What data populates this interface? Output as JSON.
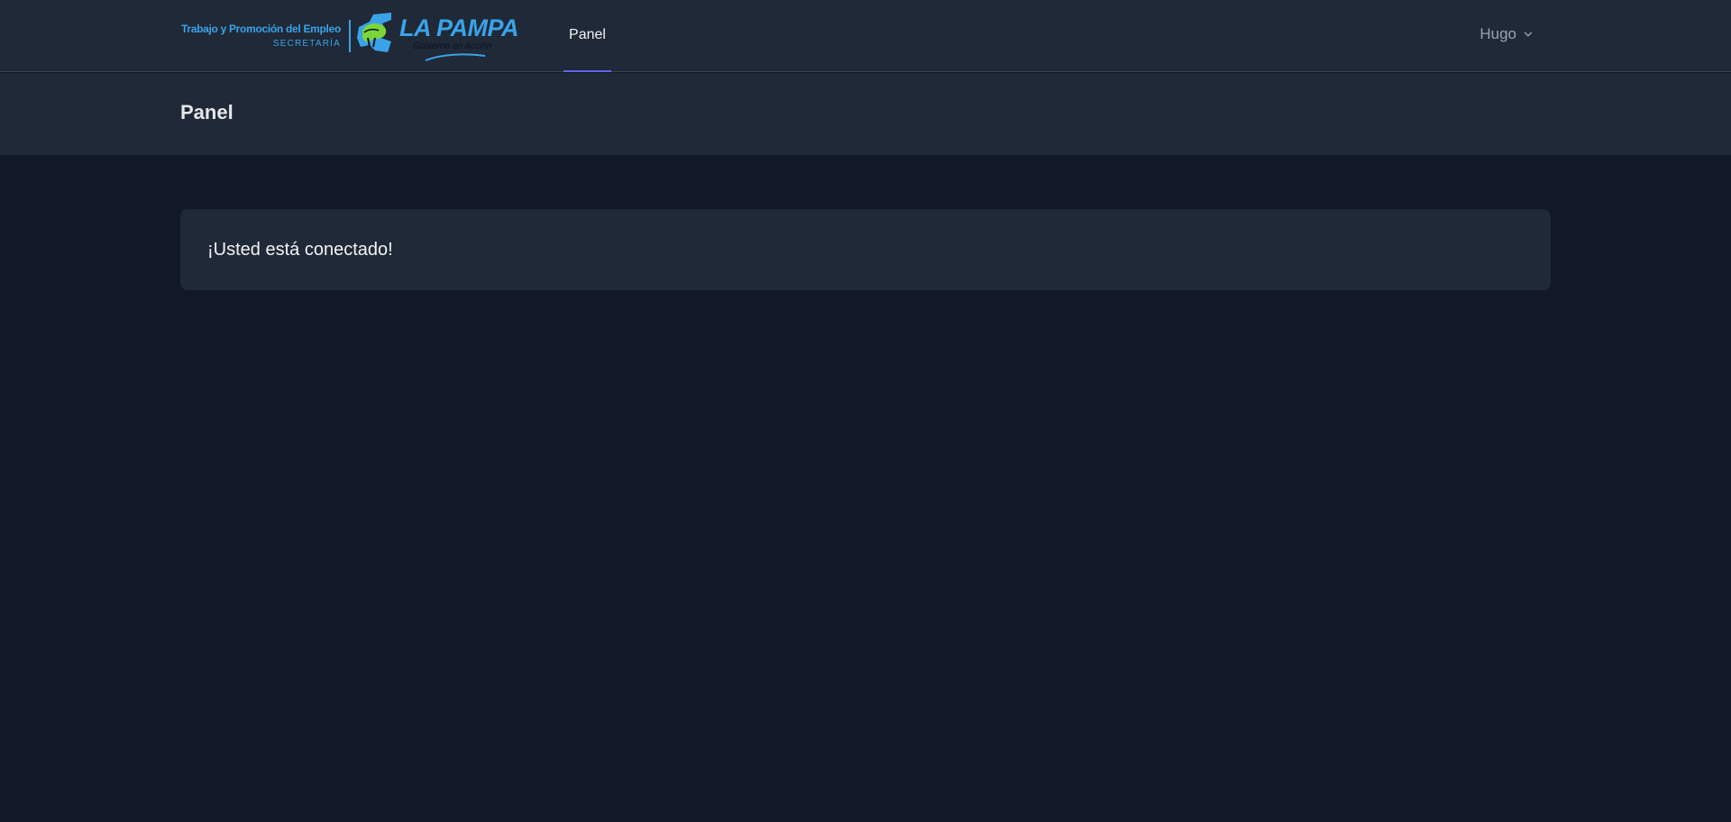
{
  "logo": {
    "title": "Trabajo y Promoción del Empleo",
    "subtitle": "SECRETARÍA",
    "brand": "LA PAMPA",
    "tagline": "Gobierno en Acción",
    "accent_color": "#3aa3e8",
    "emblem_color": "#7bd63a"
  },
  "nav": {
    "items": [
      {
        "label": "Panel",
        "active": true
      }
    ],
    "active_color": "#6366f1"
  },
  "user_menu": {
    "name": "Hugo",
    "icon": "chevron-down-icon"
  },
  "header": {
    "title": "Panel"
  },
  "main": {
    "message": "¡Usted está conectado!"
  },
  "colors": {
    "background": "#111827",
    "surface": "#1f2937",
    "border": "#374151",
    "text": "#f3f4f6",
    "muted_text": "#9ca3af"
  }
}
